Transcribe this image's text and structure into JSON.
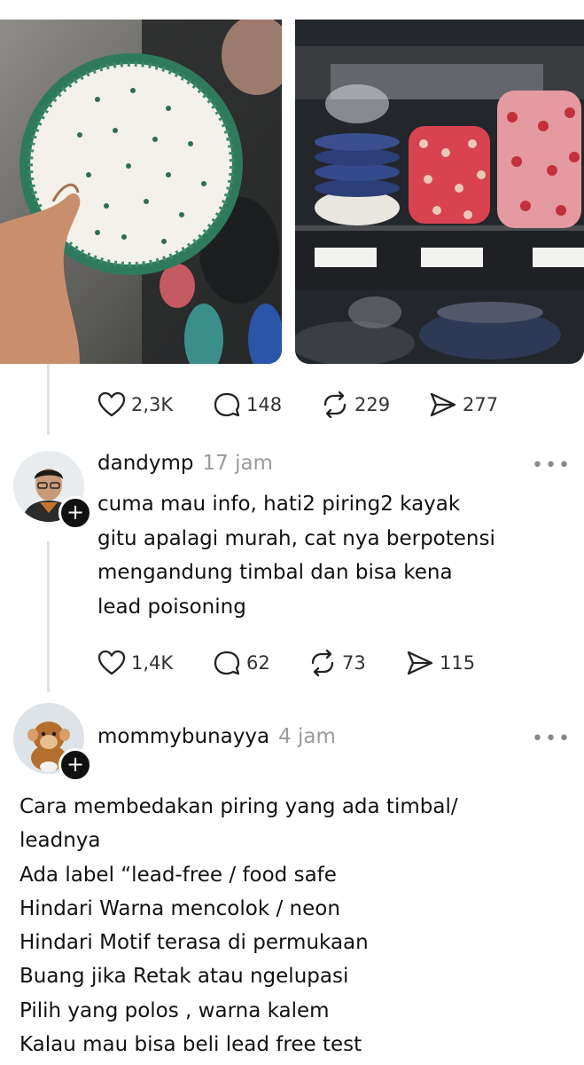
{
  "post": {
    "stats": {
      "likes": "2,3K",
      "replies": "148",
      "reposts": "229",
      "shares": "277"
    }
  },
  "reply1": {
    "username": "dandymp",
    "time": "17 jam",
    "text": "cuma mau info, hati2 piring2 kayak\ngitu apalagi murah, cat nya berpotensi\nmengandung timbal dan bisa kena\nlead poisoning",
    "stats": {
      "likes": "1,4K",
      "replies": "62",
      "reposts": "73",
      "shares": "115"
    }
  },
  "reply2": {
    "username": "mommybunayya",
    "time": "4 jam",
    "lines": [
      "Cara membedakan piring yang ada timbal/",
      "leadnya",
      "Ada label “lead-free / food safe",
      "Hindari Warna mencolok / neon",
      "Hindari Motif terasa di permukaan",
      "Buang jika Retak atau ngelupasi",
      "Pilih yang polos , warna kalem",
      "Kalau mau bisa beli lead free test"
    ]
  },
  "icons": {
    "like": "heart-icon",
    "reply": "comment-icon",
    "repost": "repost-icon",
    "share": "send-icon",
    "more": "more-icon",
    "follow": "plus-icon"
  },
  "colors": {
    "text": "#111111",
    "muted": "#9a9a9a",
    "line": "#e2e2e2",
    "plate_rim": "#2f7a5d"
  }
}
